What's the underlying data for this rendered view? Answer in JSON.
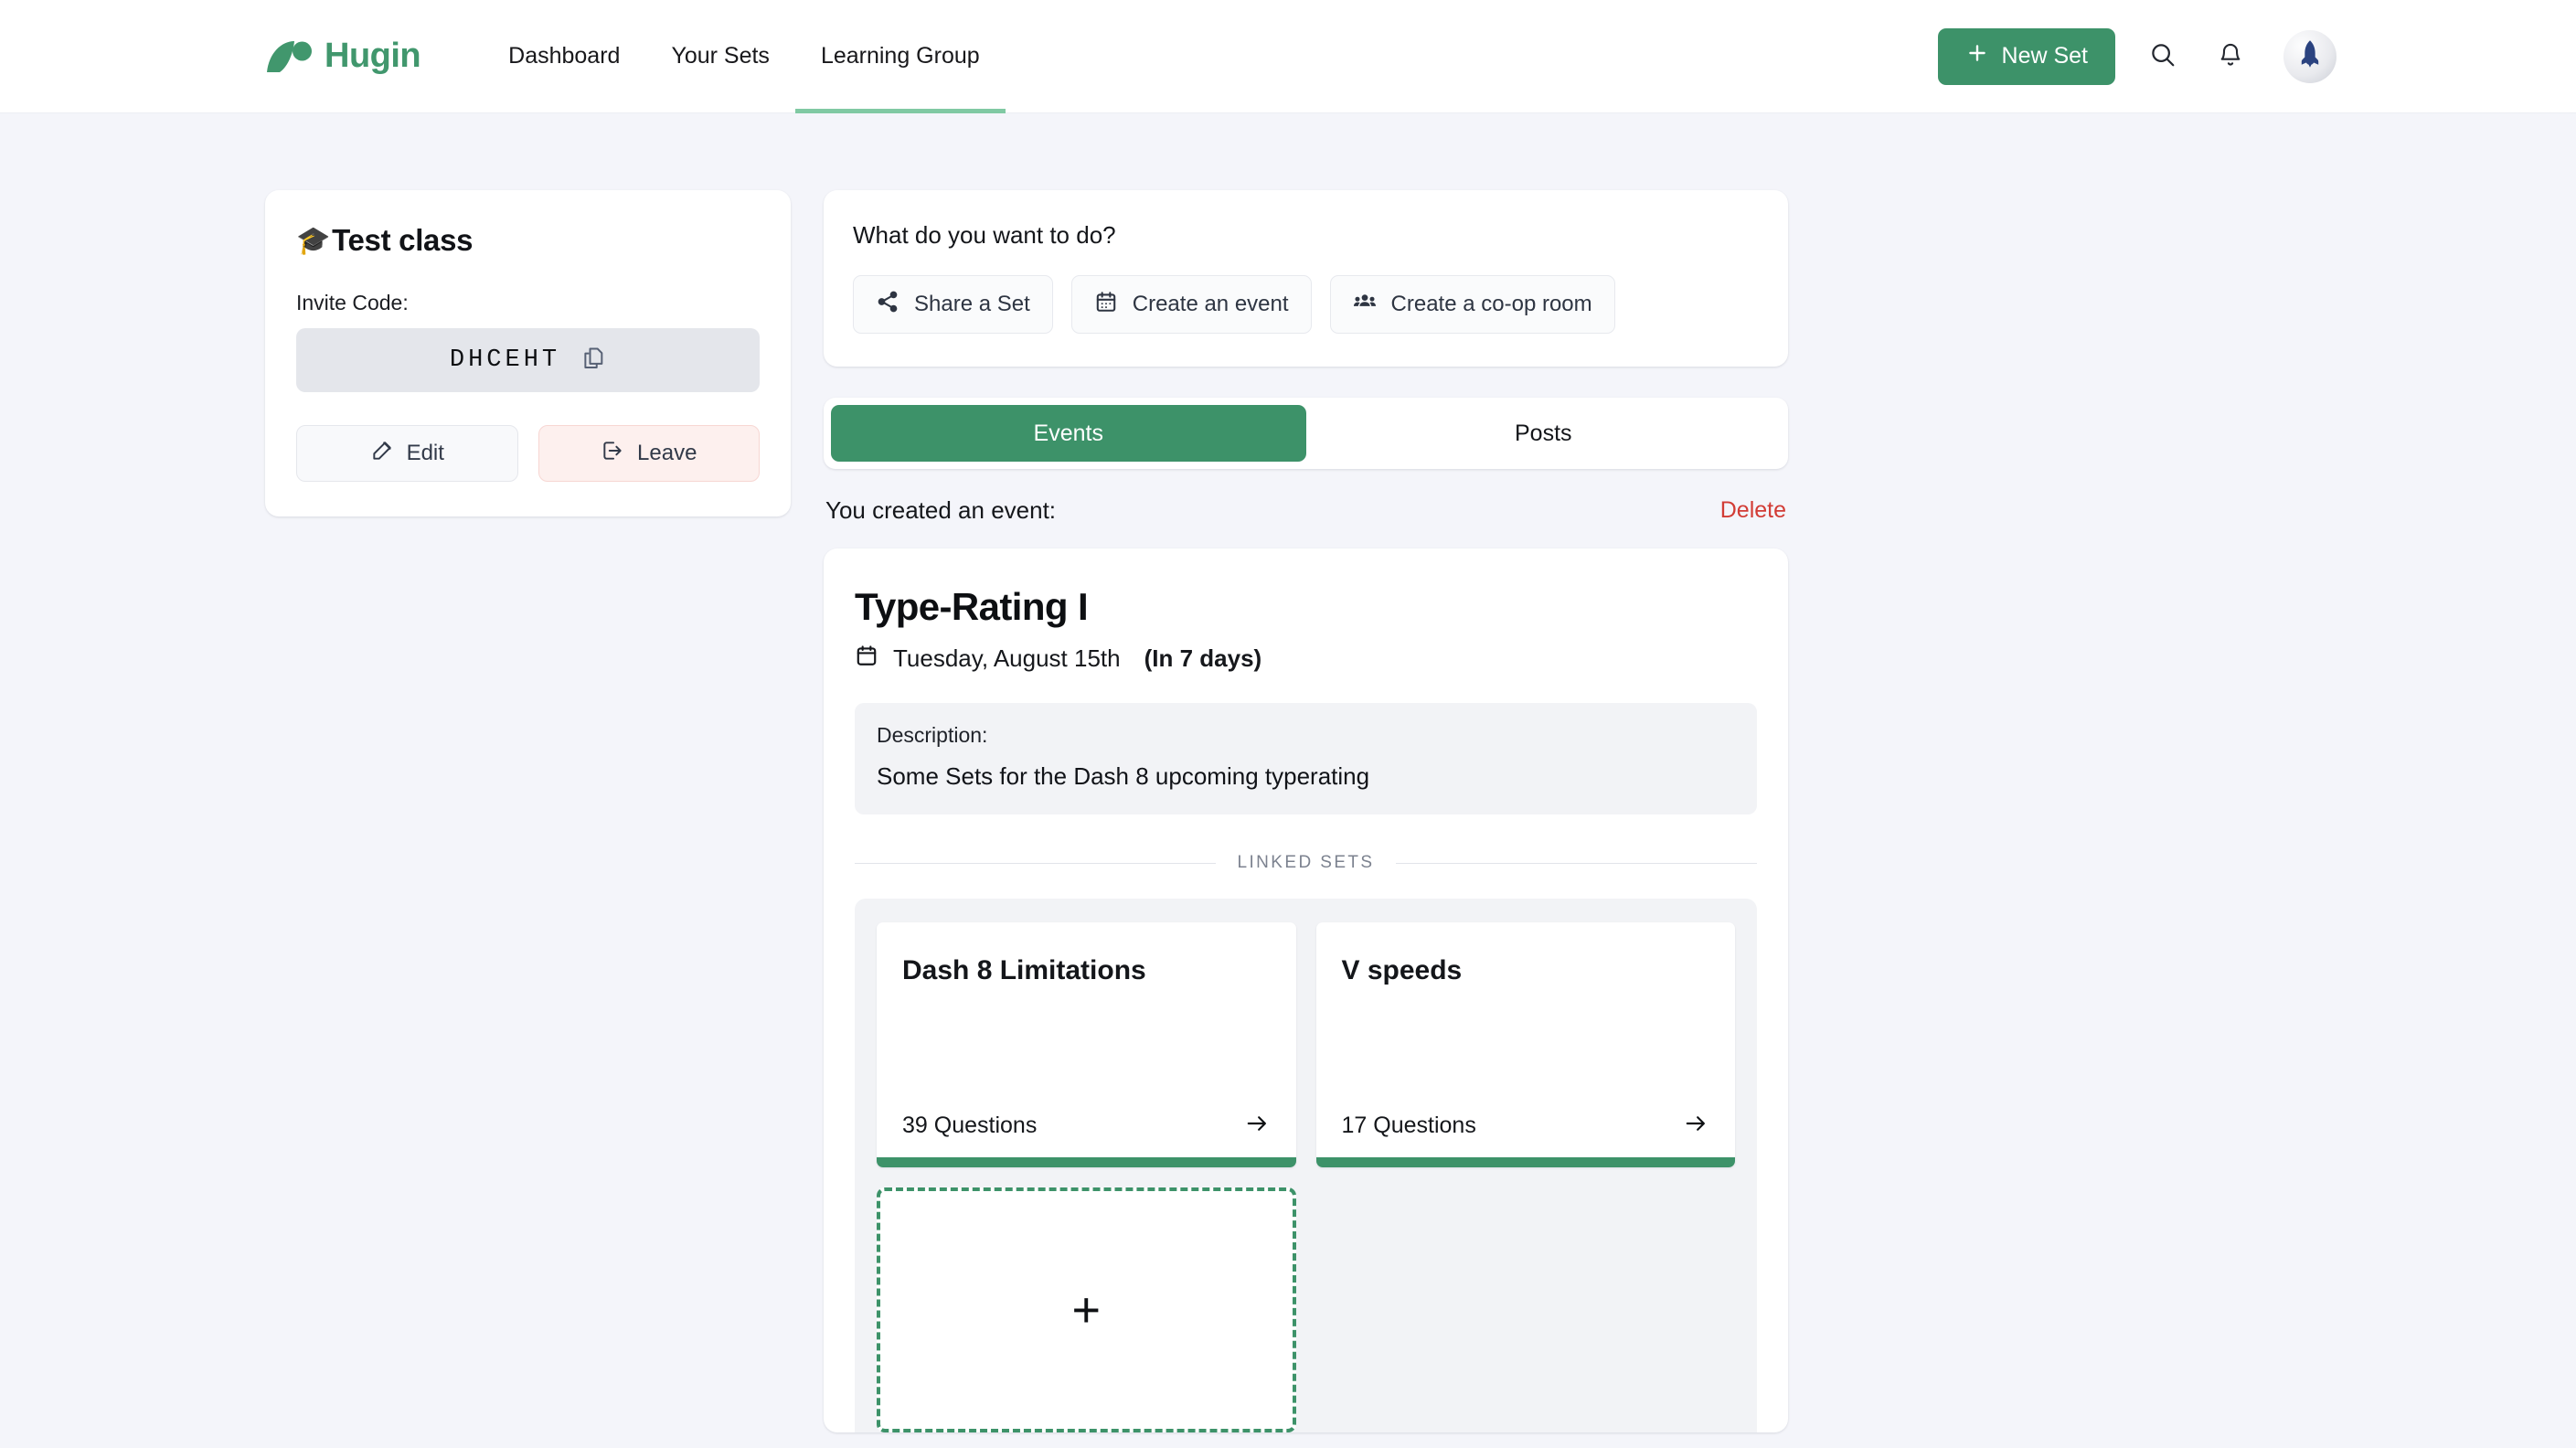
{
  "header": {
    "brand": "Hugin",
    "logo_icon": "hugin-leaf-logo",
    "nav": [
      {
        "label": "Dashboard",
        "active": false
      },
      {
        "label": "Your Sets",
        "active": false
      },
      {
        "label": "Learning Group",
        "active": true
      }
    ],
    "new_set_label": "New Set",
    "new_set_icon": "plus-icon",
    "search_icon": "search-icon",
    "notifications_icon": "bell-icon",
    "avatar_icon": "rocket-avatar-icon",
    "accent_green": "#3d9269",
    "active_tab_underline": "#80c9a3"
  },
  "class_card": {
    "emoji": "🎓",
    "title": "Test class",
    "invite_label": "Invite Code:",
    "invite_code": "DHCEHT",
    "copy_icon": "copy-icon",
    "edit_label": "Edit",
    "edit_icon": "pencil-square-icon",
    "leave_label": "Leave",
    "leave_icon": "logout-icon",
    "leave_bg": "#fdf0ee",
    "leave_border": "#f7d7d3"
  },
  "actions_card": {
    "title": "What do you want to do?",
    "buttons": [
      {
        "label": "Share a Set",
        "icon": "share-icon"
      },
      {
        "label": "Create an event",
        "icon": "calendar-icon"
      },
      {
        "label": "Create a co-op room",
        "icon": "users-icon"
      }
    ]
  },
  "tabs": [
    {
      "label": "Events",
      "active": true
    },
    {
      "label": "Posts",
      "active": false
    }
  ],
  "event_meta": {
    "label": "You created an event:",
    "delete_label": "Delete",
    "delete_color": "#d23c35"
  },
  "event": {
    "title": "Type-Rating I",
    "calendar_icon": "calendar-icon",
    "date": "Tuesday, August 15th",
    "relative": "(In 7 days)",
    "description_label": "Description:",
    "description_text": "Some Sets for the Dash 8 upcoming typerating",
    "linked_sets_divider": "LINKED SETS",
    "sets": [
      {
        "title": "Dash 8 Limitations",
        "count": "39 Questions",
        "arrow_icon": "arrow-right-icon"
      },
      {
        "title": "V speeds",
        "count": "17 Questions",
        "arrow_icon": "arrow-right-icon"
      }
    ],
    "add_set": {
      "icon": "plus-icon",
      "label": "+"
    }
  }
}
